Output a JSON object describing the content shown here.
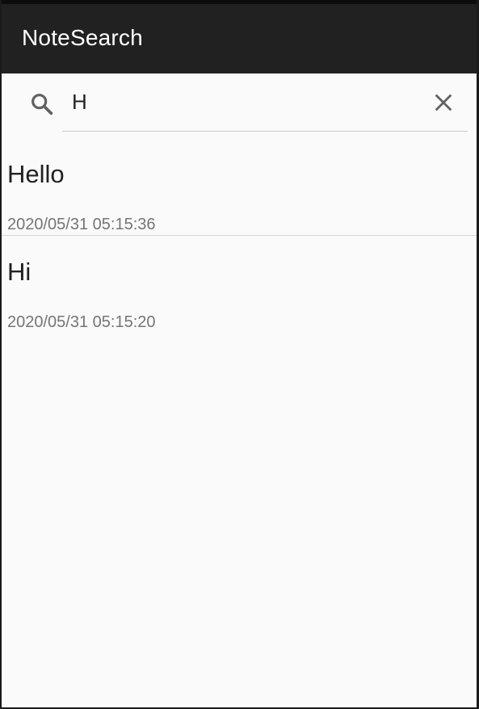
{
  "appbar": {
    "title": "NoteSearch"
  },
  "search": {
    "query": "H",
    "search_icon": "search-icon",
    "clear_icon": "close-icon"
  },
  "notes": [
    {
      "title": "Hello",
      "date": "2020/05/31 05:15:36"
    },
    {
      "title": "Hi",
      "date": "2020/05/31 05:15:20"
    }
  ],
  "colors": {
    "appbar": "#212121",
    "background": "#fafafa",
    "date_text": "#757575"
  }
}
